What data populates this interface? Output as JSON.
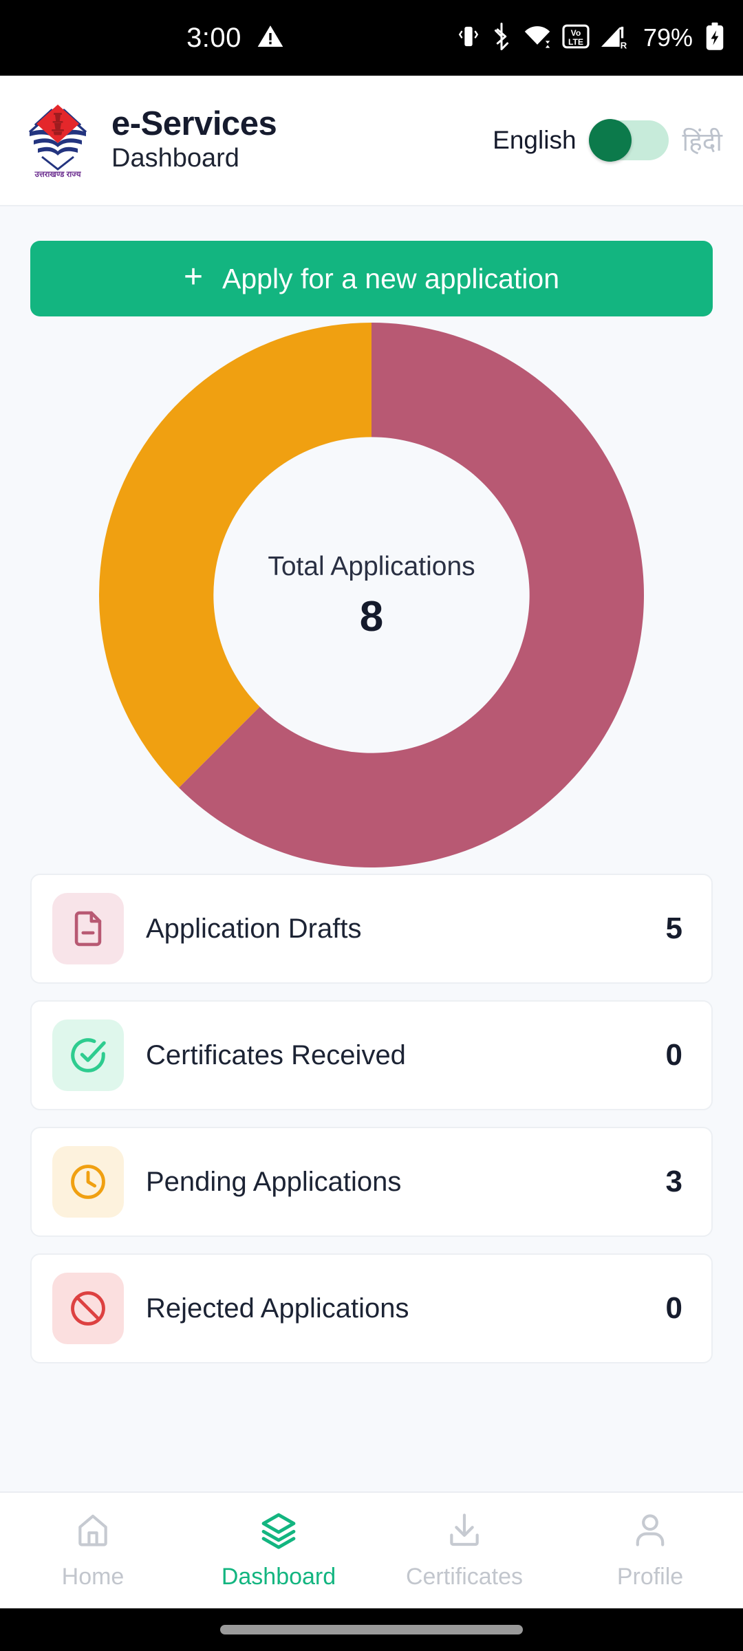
{
  "status_bar": {
    "time": "3:00",
    "battery_percent": "79%",
    "icons": [
      "warning-triangle-icon",
      "vibrate-icon",
      "bluetooth-icon",
      "wifi-icon",
      "volte-icon",
      "signal-bars-roaming-icon",
      "battery-charging-icon"
    ]
  },
  "header": {
    "logo_name": "uttarakhand-state-emblem",
    "logo_caption": "उत्तराखण्ड राज्य",
    "title": "e-Services",
    "subtitle": "Dashboard",
    "language": {
      "active_label": "English",
      "inactive_label": "हिंदी",
      "toggle_on": false
    }
  },
  "main": {
    "apply_button": {
      "plus": "+",
      "label": "Apply for a new application"
    }
  },
  "chart_data": {
    "type": "pie",
    "title": "Total Applications",
    "center_label": "Total Applications",
    "center_value": "8",
    "total": 8,
    "categories": [
      "Application Drafts",
      "Pending Applications"
    ],
    "values": [
      5,
      3
    ],
    "colors": [
      "#B85973",
      "#F0A011"
    ],
    "legend": "none",
    "start_angle_deg": 0,
    "direction": "clockwise",
    "inner_radius_ratio": 0.58
  },
  "stats": [
    {
      "icon": "document-minus-icon",
      "label": "Application Drafts",
      "count": "5",
      "icon_color": "#B85973",
      "icon_bg": "#F8E4E9"
    },
    {
      "icon": "check-circle-icon",
      "label": "Certificates Received",
      "count": "0",
      "icon_color": "#2ECC8F",
      "icon_bg": "#DFF7EC"
    },
    {
      "icon": "clock-icon",
      "label": "Pending Applications",
      "count": "3",
      "icon_color": "#F0A011",
      "icon_bg": "#FDF2DD"
    },
    {
      "icon": "ban-icon",
      "label": "Rejected Applications",
      "count": "0",
      "icon_color": "#DD4141",
      "icon_bg": "#FBDFDF"
    }
  ],
  "bottom_nav": {
    "items": [
      {
        "icon": "home-icon",
        "label": "Home",
        "active": false
      },
      {
        "icon": "layers-icon",
        "label": "Dashboard",
        "active": true
      },
      {
        "icon": "download-icon",
        "label": "Certificates",
        "active": false
      },
      {
        "icon": "person-icon",
        "label": "Profile",
        "active": false
      }
    ]
  },
  "theme": {
    "accent_green": "#13B580",
    "toggle_green": "#0C7A4B",
    "pink": "#B85973",
    "orange": "#F0A011",
    "page_bg": "#F7F9FC"
  }
}
